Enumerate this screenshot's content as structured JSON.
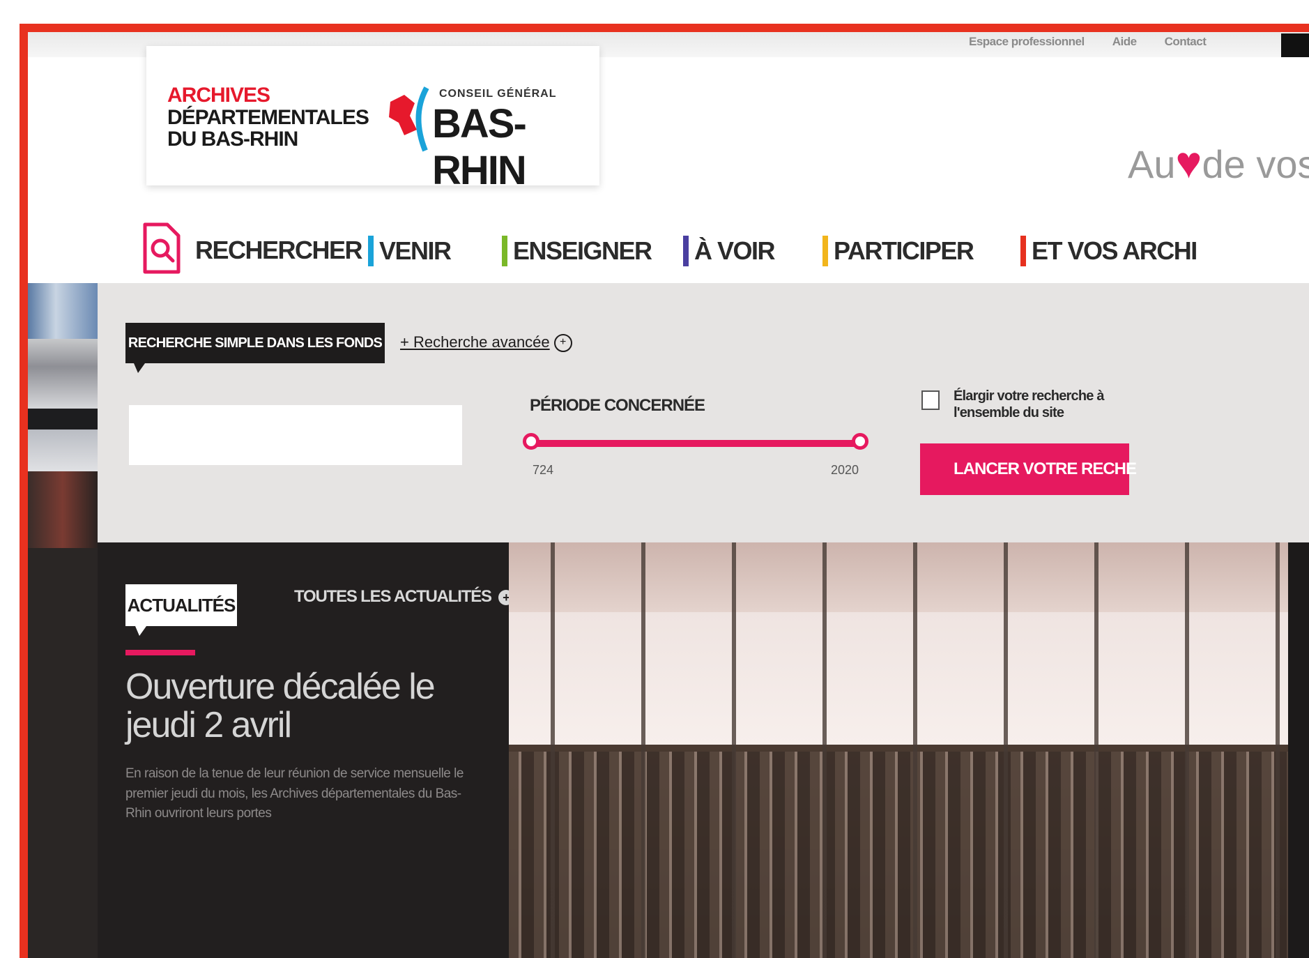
{
  "utility_links": [
    "Espace professionnel",
    "Aide",
    "Contact"
  ],
  "logo": {
    "archives_line1": "ARCHIVES",
    "archives_line2": "DÉPARTEMENTALES",
    "archives_line3": "DU BAS-RHIN",
    "cg_top": "CONSEIL GÉNÉRAL",
    "cg_main": "BAS-RHIN"
  },
  "tagline": {
    "prefix": "Au",
    "suffix": "de vos"
  },
  "nav": {
    "items": [
      {
        "label": "RECHERCHER",
        "color": "#e6195f"
      },
      {
        "label": "VENIR",
        "color": "#1aa3d9"
      },
      {
        "label": "ENSEIGNER",
        "color": "#7ab828"
      },
      {
        "label": "À VOIR",
        "color": "#4a3fa0"
      },
      {
        "label": "PARTICIPER",
        "color": "#f2b51c"
      },
      {
        "label": "ET VOS ARCHI",
        "color": "#e6311f"
      }
    ]
  },
  "search": {
    "tab_label": "RECHERCHE SIMPLE DANS LES FONDS",
    "advanced_link": "Recherche avancée",
    "input_value": "",
    "input_placeholder": "",
    "period_label": "PÉRIODE CONCERNÉE",
    "period_min": "724",
    "period_max": "2020",
    "checkbox_label": "Élargir votre recherche à l'ensemble du site",
    "checkbox_checked": false,
    "button_label": "LANCER VOTRE RECHE"
  },
  "news": {
    "badge": "ACTUALITÉS",
    "all_link": "TOUTES LES ACTUALITÉS",
    "title": "Ouverture décalée le jeudi 2 avril",
    "excerpt": "En raison de la tenue de leur réunion de service mensuelle le premier jeudi du mois, les Archives départementales du Bas-Rhin ouvriront leurs portes"
  },
  "colors": {
    "accent": "#e6195f",
    "frame": "#e8311f",
    "dark": "#221f1f"
  },
  "icons": [
    "search-document-icon",
    "heart-icon",
    "plus-circle-icon"
  ]
}
